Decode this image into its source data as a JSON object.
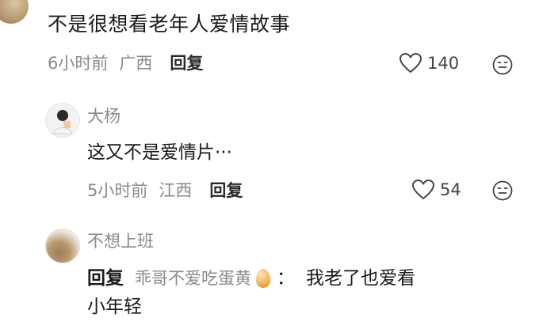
{
  "comment": {
    "text": "不是很想看老年人爱情故事",
    "time": "6小时前",
    "location": "广西",
    "reply_label": "回复",
    "likes": "140",
    "icons": [
      "heart-outline-icon",
      "emoji-face-icon"
    ]
  },
  "replies": [
    {
      "username": "大杨",
      "text": "这又不是爱情片···",
      "time": "5小时前",
      "location": "江西",
      "reply_label": "回复",
      "likes": "54"
    },
    {
      "username": "不想上班",
      "reply_tag": "回复",
      "reply_target": "乖哥不爱吃蛋黄",
      "reply_target_emoji": "egg-emoji",
      "colon": "：",
      "text_line1": "我老了也爱看",
      "text_line2": "小年轻"
    }
  ],
  "colors": {
    "primary_text": "#1a1a1a",
    "secondary_text": "#8a8a8a",
    "icon": "#444444"
  }
}
